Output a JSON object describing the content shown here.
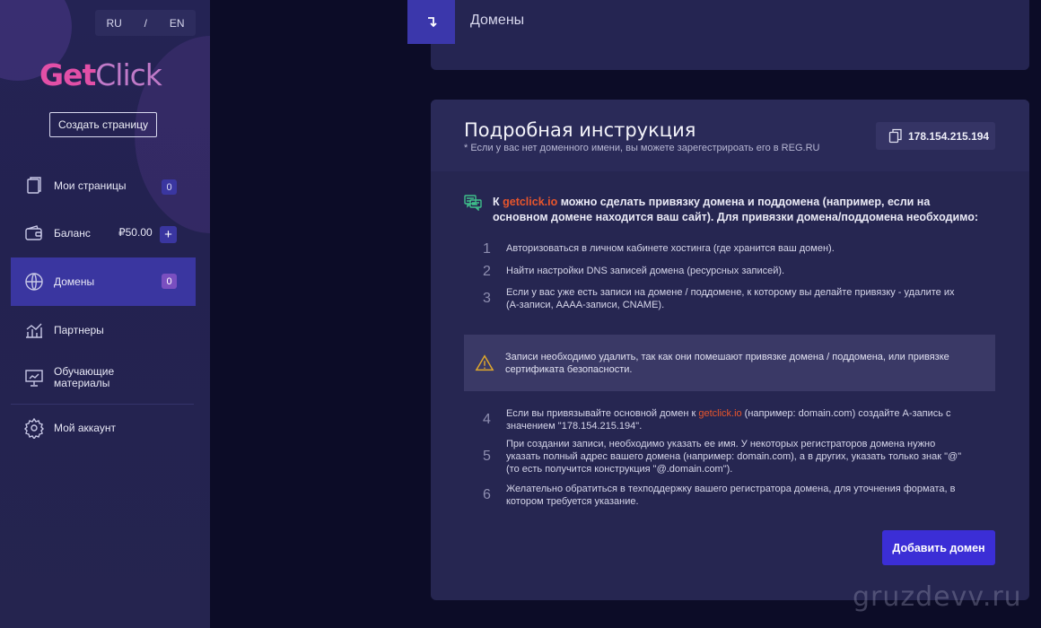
{
  "lang": {
    "ru": "RU",
    "sep": "/",
    "en": "EN"
  },
  "logo": {
    "get": "Get",
    "click": "Click"
  },
  "sidebar": {
    "create_label": "Создать страницу",
    "items": [
      {
        "label": "Мои страницы",
        "badge": "0",
        "icon": "pages-icon"
      },
      {
        "label": "Баланс",
        "amount": "₽50.00",
        "badge": "+",
        "icon": "wallet-icon"
      },
      {
        "label": "Домены",
        "badge": "0",
        "icon": "globe-icon",
        "active": true
      },
      {
        "label": "Партнеры",
        "icon": "partners-chart-icon"
      },
      {
        "label": "Обучающие материалы",
        "icon": "presentation-icon"
      },
      {
        "label": "Мой аккаунт",
        "icon": "gear-icon"
      }
    ]
  },
  "header": {
    "title": "Домены",
    "icon": "turn-down-arrow-icon"
  },
  "card": {
    "title": "Подробная инструкция",
    "subtitle": "* Если у вас нет доменного имени, вы можете зарегестрироать его в REG.RU",
    "ip": "178.154.215.194",
    "intro_before": "К ",
    "intro_link": "getclick.io",
    "intro_after": " можно сделать привязку домена и поддомена (например, если на основном домене находится ваш сайт). Для привязки домена/поддомена необходимо:",
    "steps": [
      {
        "num": "1",
        "text": "Авторизоваться в личном кабинете хостинга (где хранится ваш домен)."
      },
      {
        "num": "2",
        "text": "Найти настройки DNS записей домена (ресурсных записей)."
      },
      {
        "num": "3",
        "text": "Если у вас уже есть записи на домене / поддомене, к которому вы делайте привязку - удалите их (A-записи, AAAA-записи, CNAME)."
      }
    ],
    "warning": "Записи необходимо удалить, так как они помешают привязке домена / поддомена, или привязке сертификата безопасности.",
    "step4": {
      "num": "4",
      "before": "Если вы привязывайте основной домен к ",
      "link": "getclick.io",
      "after": " (например: domain.com) создайте A-запись с значением \"178.154.215.194\"."
    },
    "steps_more": [
      {
        "num": "5",
        "text": "При создании записи, необходимо указать ее имя. У некоторых регистраторов домена нужно указать полный адрес вашего домена (например: domain.com), а в других, указать только знак \"@\" (то есть получится конструкция \"@.domain.com\")."
      },
      {
        "num": "6",
        "text": "Желательно обратиться в техподдержку вашего регистратора домена, для уточнения формата, в котором требуется указание."
      }
    ],
    "add_button": "Добавить домен"
  },
  "watermark": "gruzdevv.ru",
  "colors": {
    "accent": "#e8552c",
    "primary": "#3b2ed6",
    "active": "#3a36a0"
  }
}
